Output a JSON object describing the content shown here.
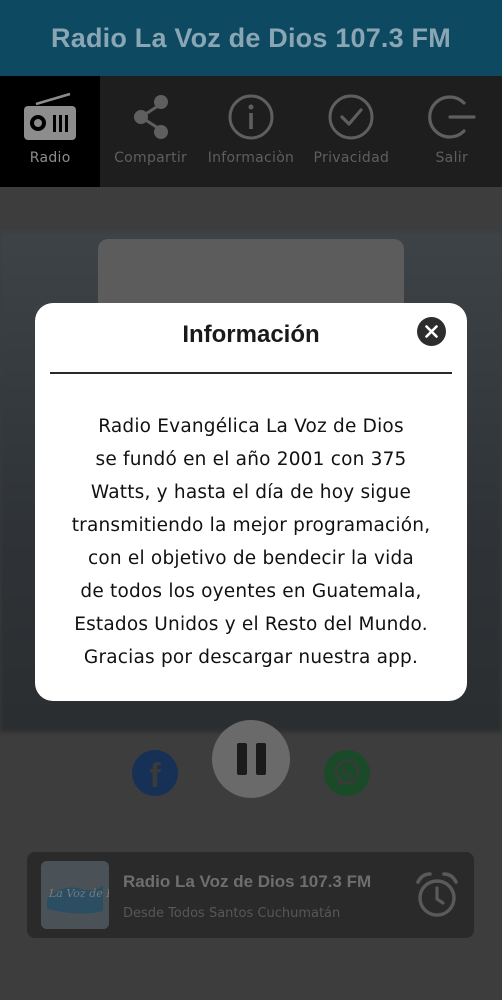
{
  "header": {
    "title": "Radio La Voz de Dios 107.3 FM"
  },
  "tabs": [
    {
      "label": "Radio",
      "icon": "radio-icon",
      "active": true
    },
    {
      "label": "Compartir",
      "icon": "share-icon",
      "active": false
    },
    {
      "label": "Informaciòn",
      "icon": "info-icon",
      "active": false
    },
    {
      "label": "Privacidad",
      "icon": "check-circle-icon",
      "active": false
    },
    {
      "label": "Salir",
      "icon": "exit-icon",
      "active": false
    }
  ],
  "player": {
    "facebook_icon": "facebook-icon",
    "pause_icon": "pause-icon",
    "whatsapp_icon": "whatsapp-icon"
  },
  "now_playing": {
    "title": "Radio La Voz de Dios 107.3 FM",
    "subtitle": "Desde Todos Santos Cuchumatán",
    "logo_text": "La Voz de Dios",
    "alarm_icon": "alarm-clock-icon"
  },
  "dialog": {
    "title": "Información",
    "close_icon": "close-icon",
    "lines": [
      "Radio Evangélica La Voz de Dios",
      "se fundó en el año 2001 con 375",
      "Watts, y hasta el día de hoy sigue",
      "transmitiendo la mejor programación,",
      "con el objetivo de bendecir la vida",
      "de todos los oyentes en Guatemala,",
      "Estados Unidos y el Resto del Mundo.",
      "Gracias por descargar nuestra app."
    ]
  },
  "colors": {
    "header_bg": "#0d4a62",
    "overlay_dim": "rgba(0,0,0,0.55)",
    "dialog_bg": "#ffffff"
  }
}
